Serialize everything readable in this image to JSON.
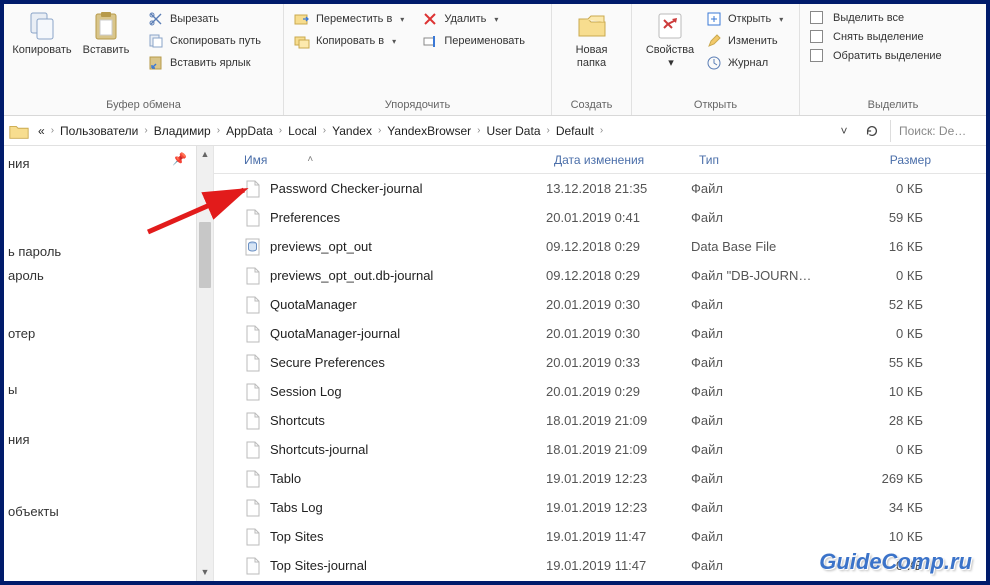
{
  "ribbon": {
    "clipboard": {
      "label": "Буфер обмена",
      "copy": "Копировать",
      "paste": "Вставить",
      "cut": "Вырезать",
      "copy_path": "Скопировать путь",
      "paste_shortcut": "Вставить ярлык"
    },
    "organize": {
      "label": "Упорядочить",
      "move_to": "Переместить в",
      "copy_to": "Копировать в",
      "delete": "Удалить",
      "rename": "Переименовать"
    },
    "create": {
      "label": "Создать",
      "new_folder_l1": "Новая",
      "new_folder_l2": "папка"
    },
    "open": {
      "label": "Открыть",
      "properties": "Свойства",
      "open": "Открыть",
      "edit": "Изменить",
      "history": "Журнал"
    },
    "select": {
      "label": "Выделить",
      "select_all": "Выделить все",
      "select_none": "Снять выделение",
      "invert": "Обратить выделение"
    }
  },
  "breadcrumbs": [
    "Пользователи",
    "Владимир",
    "AppData",
    "Local",
    "Yandex",
    "YandexBrowser",
    "User Data",
    "Default"
  ],
  "breadcrumb_prefix": "«",
  "search_placeholder": "Поиск: De…",
  "nav_items": [
    "ния",
    "ь пароль",
    "ароль",
    "отер",
    "ы",
    "ния",
    "объекты"
  ],
  "columns": {
    "name": "Имя",
    "date": "Дата изменения",
    "type": "Тип",
    "size": "Размер"
  },
  "files": [
    {
      "name": "Password Checker-journal",
      "date": "13.12.2018 21:35",
      "type": "Файл",
      "size": "0 КБ",
      "icon": "blank"
    },
    {
      "name": "Preferences",
      "date": "20.01.2019 0:41",
      "type": "Файл",
      "size": "59 КБ",
      "icon": "blank"
    },
    {
      "name": "previews_opt_out",
      "date": "09.12.2018 0:29",
      "type": "Data Base File",
      "size": "16 КБ",
      "icon": "db"
    },
    {
      "name": "previews_opt_out.db-journal",
      "date": "09.12.2018 0:29",
      "type": "Файл \"DB-JOURN…",
      "size": "0 КБ",
      "icon": "blank"
    },
    {
      "name": "QuotaManager",
      "date": "20.01.2019 0:30",
      "type": "Файл",
      "size": "52 КБ",
      "icon": "blank"
    },
    {
      "name": "QuotaManager-journal",
      "date": "20.01.2019 0:30",
      "type": "Файл",
      "size": "0 КБ",
      "icon": "blank"
    },
    {
      "name": "Secure Preferences",
      "date": "20.01.2019 0:33",
      "type": "Файл",
      "size": "55 КБ",
      "icon": "blank"
    },
    {
      "name": "Session Log",
      "date": "20.01.2019 0:29",
      "type": "Файл",
      "size": "10 КБ",
      "icon": "blank"
    },
    {
      "name": "Shortcuts",
      "date": "18.01.2019 21:09",
      "type": "Файл",
      "size": "28 КБ",
      "icon": "blank"
    },
    {
      "name": "Shortcuts-journal",
      "date": "18.01.2019 21:09",
      "type": "Файл",
      "size": "0 КБ",
      "icon": "blank"
    },
    {
      "name": "Tablo",
      "date": "19.01.2019 12:23",
      "type": "Файл",
      "size": "269 КБ",
      "icon": "blank"
    },
    {
      "name": "Tabs Log",
      "date": "19.01.2019 12:23",
      "type": "Файл",
      "size": "34 КБ",
      "icon": "blank"
    },
    {
      "name": "Top Sites",
      "date": "19.01.2019 11:47",
      "type": "Файл",
      "size": "10 КБ",
      "icon": "blank"
    },
    {
      "name": "Top Sites-journal",
      "date": "19.01.2019 11:47",
      "type": "Файл",
      "size": "0 КБ",
      "icon": "blank"
    }
  ],
  "watermark": "GuideComp.ru"
}
